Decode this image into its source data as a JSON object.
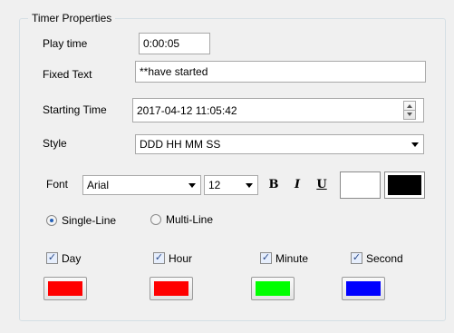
{
  "group": {
    "title": "Timer Properties"
  },
  "play_time": {
    "label": "Play time",
    "value": "0:00:05"
  },
  "fixed_text": {
    "label": "Fixed Text",
    "value": "**have started"
  },
  "starting_time": {
    "label": "Starting Time",
    "value": "2017-04-12 11:05:42"
  },
  "style": {
    "label": "Style",
    "value": "DDD HH MM SS"
  },
  "font": {
    "label": "Font",
    "family": "Arial",
    "size": "12",
    "bold_label": "B",
    "italic_label": "I",
    "underline_label": "U",
    "background_color": "#ffffff",
    "text_color": "#000000"
  },
  "line_mode": {
    "single": {
      "label": "Single-Line",
      "checked": true
    },
    "multi": {
      "label": "Multi-Line",
      "checked": false
    }
  },
  "units": [
    {
      "label": "Day",
      "checked": true,
      "color": "#ff0000"
    },
    {
      "label": "Hour",
      "checked": true,
      "color": "#ff0000"
    },
    {
      "label": "Minute",
      "checked": true,
      "color": "#00ff00"
    },
    {
      "label": "Second",
      "checked": true,
      "color": "#0000ff"
    }
  ]
}
